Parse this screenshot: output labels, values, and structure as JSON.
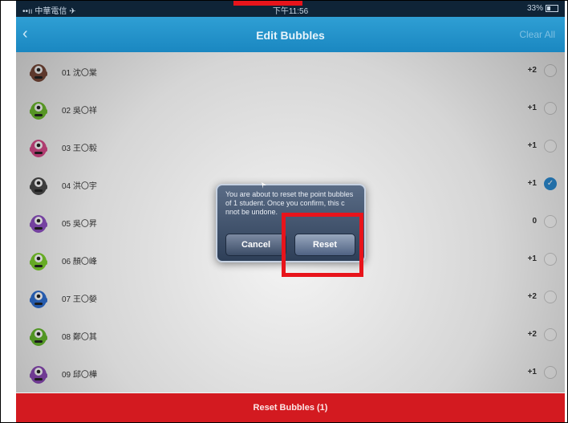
{
  "status_bar": {
    "carrier": "••ıı 中華電信 ✈",
    "time": "下午11:56",
    "battery": "33%"
  },
  "navbar": {
    "back": "‹",
    "title": "Edit Bubbles",
    "clear": "Clear All"
  },
  "students": [
    {
      "name": "01 沈〇棠",
      "points": "+2",
      "checked": false,
      "color": "#7b4a3a"
    },
    {
      "name": "02 吳〇祥",
      "points": "+1",
      "checked": false,
      "color": "#6fbf2e"
    },
    {
      "name": "03 王〇毅",
      "points": "+1",
      "checked": false,
      "color": "#d94a8b"
    },
    {
      "name": "04 洪〇宇",
      "points": "+1",
      "checked": true,
      "color": "#4a4a4a"
    },
    {
      "name": "05 吳〇昇",
      "points": "0",
      "checked": false,
      "color": "#8d4fc2"
    },
    {
      "name": "06 顏〇峰",
      "points": "+1",
      "checked": false,
      "color": "#7ccf2c"
    },
    {
      "name": "07 王〇嫈",
      "points": "+2",
      "checked": false,
      "color": "#2f6fd1"
    },
    {
      "name": "08 鄭〇其",
      "points": "+2",
      "checked": false,
      "color": "#64b82c"
    },
    {
      "name": "09 邱〇樺",
      "points": "+1",
      "checked": false,
      "color": "#8c4ab8"
    }
  ],
  "dialog": {
    "message": "You are about to reset the point bubbles of 1 student. Once you confirm, this c   nnot be undone.",
    "cancel": "Cancel",
    "reset": "Reset"
  },
  "bottom_button": "Reset Bubbles (1)",
  "colors": {
    "accent": "#1a87c1",
    "danger": "#d31a20",
    "highlight": "#e8141b"
  }
}
